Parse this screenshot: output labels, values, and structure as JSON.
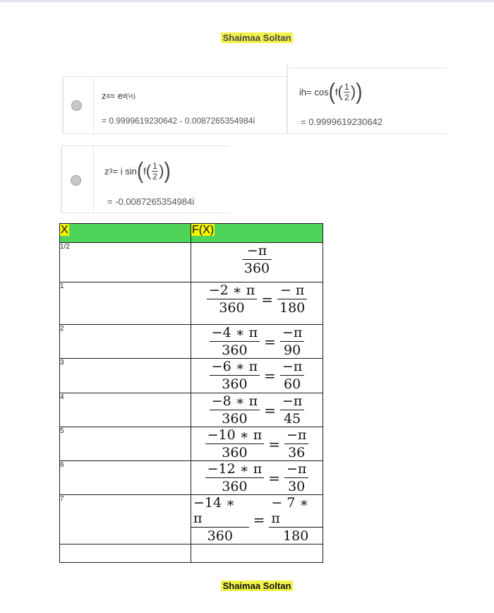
{
  "author": "Shaimaa Soltan",
  "cells": {
    "z4": {
      "def_lhs": "z",
      "def_sub": "4",
      "def_rest": " = e",
      "def_sup": "if(½)",
      "value": "= 0.9999619230642 - 0.0087265354984ί"
    },
    "ih": {
      "def_lhs": "ih",
      "def_eq": " = ",
      "def_fn": "cos",
      "def_inner": "f",
      "frac_num": "1",
      "frac_den": "2",
      "value": "= 0.9999619230642"
    },
    "z3": {
      "def_lhs": "z",
      "def_sub": "3",
      "def_rest": " = i  sin",
      "def_inner": "f",
      "frac_num": "1",
      "frac_den": "2",
      "value": "= -0.0087265354984ί"
    }
  },
  "table": {
    "headers": [
      "X",
      "F(X)"
    ],
    "rows": [
      {
        "x": "1/2",
        "n1": "−π",
        "d1": "360",
        "n2": "",
        "d2": ""
      },
      {
        "x": "1",
        "n1": "−2 ∗ π",
        "d1": "360",
        "n2": "− π",
        "d2": "180"
      },
      {
        "x": "2",
        "n1": "−4 ∗ π",
        "d1": "360",
        "n2": "−π",
        "d2": "90"
      },
      {
        "x": "3",
        "n1": "−6 ∗ π",
        "d1": "360",
        "n2": "−π",
        "d2": "60"
      },
      {
        "x": "4",
        "n1": "−8 ∗ π",
        "d1": "360",
        "n2": "−π",
        "d2": "45"
      },
      {
        "x": "5",
        "n1": "−10 ∗ π",
        "d1": "360",
        "n2": "−π",
        "d2": "36"
      },
      {
        "x": "6",
        "n1": "−12 ∗ π",
        "d1": "360",
        "n2": "−π",
        "d2": "30"
      },
      {
        "x": "7",
        "n1": "−14 ∗ π",
        "d1": "360",
        "n2": "− 7 ∗ π",
        "d2": "180"
      },
      {
        "x": "",
        "n1": "",
        "d1": "",
        "n2": "",
        "d2": ""
      }
    ],
    "eq_sign": "="
  },
  "colors": {
    "header_green": "#4fd45a",
    "highlight_yellow": "#f5f500",
    "radio_gray": "#c8c8c8"
  }
}
